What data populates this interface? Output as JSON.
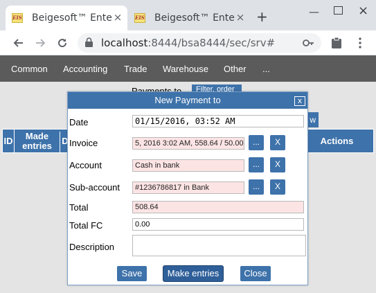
{
  "browser": {
    "tabs": [
      {
        "label": "Beigesoft™ Ente",
        "favicon": "EIS"
      },
      {
        "label": "Beigesoft™ Ente",
        "favicon": "EIS"
      }
    ],
    "url_host": "localhost",
    "url_rest": ":8444/bsa8444/sec/srv#"
  },
  "nav": {
    "items": [
      "Common",
      "Accounting",
      "Trade",
      "Warehouse",
      "Other",
      "..."
    ]
  },
  "page": {
    "title": "Payments to",
    "filter_label": "Filter, order",
    "new_label": "w",
    "columns": [
      "ID",
      "Made entries",
      "D",
      "Actions"
    ]
  },
  "dialog": {
    "title": "New Payment to",
    "close_label": "x",
    "fields": {
      "date": {
        "label": "Date",
        "value": "01/15/2016, 03:52 AM"
      },
      "invoice": {
        "label": "Invoice",
        "value": "5, 2016 3:02 AM, 558.64 / 50.00,"
      },
      "account": {
        "label": "Account",
        "value": "Cash in bank"
      },
      "subaccount": {
        "label": "Sub-account",
        "value": "#1236786817 in Bank"
      },
      "total": {
        "label": "Total",
        "value": "508.64"
      },
      "total_fc": {
        "label": "Total FC",
        "value": "0.00"
      },
      "description": {
        "label": "Description",
        "value": ""
      }
    },
    "pick_label": "...",
    "clear_label": "X",
    "buttons": {
      "save": "Save",
      "make_entries": "Make entries",
      "close": "Close"
    }
  }
}
